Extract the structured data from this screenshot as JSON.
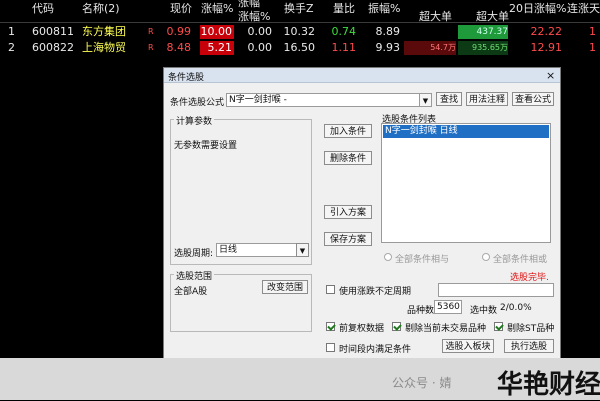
{
  "table": {
    "headers": [
      "代码",
      "名称(2)",
      "",
      "现价",
      "涨幅%",
      "涨幅%",
      "换手Z",
      "量比",
      "振幅%",
      "超大单",
      "超大单",
      "20日涨幅%",
      "连涨天"
    ],
    "header_top": {
      "col_zhangfu2": "涨幅",
      "col_zhanghou": "涨幅%",
      "col_cd": "超大单"
    },
    "rows": [
      {
        "idx": "1",
        "code": "600811",
        "name": "东方集团",
        "flag": "R",
        "price": "0.99",
        "chg": "10.00",
        "chg2": "0.00",
        "turnover": "10.32",
        "vol_ratio": "0.74",
        "amplitude": "8.89",
        "big1": "",
        "big2": "437.37",
        "twenty": "22.22",
        "streak": "1"
      },
      {
        "idx": "2",
        "code": "600822",
        "name": "上海物贸",
        "flag": "R",
        "price": "8.48",
        "chg": "5.21",
        "chg2": "0.00",
        "turnover": "16.50",
        "vol_ratio": "1.11",
        "amplitude": "9.93",
        "big1": "54.7万",
        "big2": "935.65万",
        "twenty": "12.91",
        "streak": "1"
      }
    ]
  },
  "dialog": {
    "title": "条件选股",
    "formula_label": "条件选股公式",
    "formula_value": "N字一剑封喉  -",
    "buttons": {
      "find": "查找",
      "usage": "用法注释",
      "view_formula": "查看公式",
      "add": "加入条件",
      "delete": "删除条件",
      "import": "引入方案",
      "save": "保存方案",
      "change_range": "改变范围",
      "to_block": "选股入板块",
      "execute": "执行选股",
      "close": "关闭"
    },
    "params_title": "计算参数",
    "params_text": "无参数需要设置",
    "period_label": "选股周期:",
    "period_value": "日线",
    "conditions_title": "选股条件列表",
    "condition_item": "N字一剑封喉  日线",
    "radio_and": "全部条件相与",
    "radio_or": "全部条件相或",
    "done_text": "选股完毕.",
    "range_title": "选股范围",
    "range_value": "全部A股",
    "use_uncertain": "使用涨跌不定周期",
    "count_label": "品种数",
    "count_value": "5360",
    "selected_label": "选中数",
    "selected_value": "2/0.0%",
    "pre_restore": "前复权数据",
    "remove_untraded": "剔除当前未交易品种",
    "remove_st": "剔除ST品种",
    "period_satisfy": "时间段内满足条件"
  },
  "watermark": {
    "source": "公众号 · 婧",
    "brand": "华艳财经"
  },
  "colors": {
    "table_bg": "#000000",
    "red": "#ff4b4b",
    "green": "#3fdc3f",
    "yellow": "#ffff55",
    "dialog_bg": "#f0f0f0",
    "selection": "#1f6fc4",
    "done_red": "#e01010"
  }
}
